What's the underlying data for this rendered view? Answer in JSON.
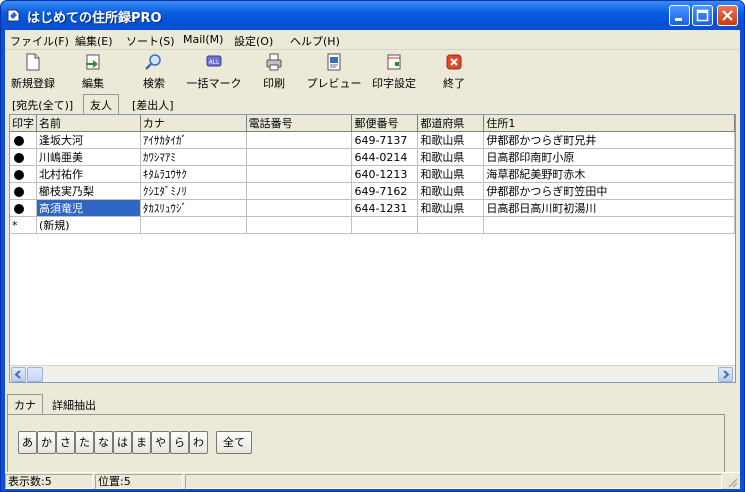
{
  "window": {
    "title": "はじめての住所録PRO",
    "title_color": "#0a4fd6"
  },
  "menubar": [
    "ファイル(F)",
    "編集(E)",
    "ソート(S)",
    "Mail(M)",
    "設定(O)",
    "ヘルプ(H)"
  ],
  "toolbar": [
    {
      "label": "新規登録",
      "icon": "new-document-icon"
    },
    {
      "label": "編集",
      "icon": "edit-icon"
    },
    {
      "label": "検索",
      "icon": "search-icon"
    },
    {
      "label": "一括マーク",
      "icon": "mark-all-icon"
    },
    {
      "label": "印刷",
      "icon": "printer-icon"
    },
    {
      "label": "プレビュー",
      "icon": "preview-icon"
    },
    {
      "label": "印字設定",
      "icon": "print-setup-icon"
    },
    {
      "label": "終了",
      "icon": "exit-icon"
    }
  ],
  "list_tabs": [
    "[宛先(全て)]",
    "友人",
    "[差出人]"
  ],
  "active_list_tab": "友人",
  "grid": {
    "columns": [
      "印字",
      "名前",
      "カナ",
      "電話番号",
      "郵便番号",
      "都道府県",
      "住所1"
    ],
    "rows": [
      {
        "mark": true,
        "name": "逢坂大河",
        "kana": "ｱｲｻｶﾀｲｶﾞ",
        "phone": "",
        "zip": "649-7137",
        "pref": "和歌山県",
        "addr": "伊都郡かつらぎ町兄井"
      },
      {
        "mark": true,
        "name": "川嶋亜美",
        "kana": "ｶﾜｼﾏｱﾐ",
        "phone": "",
        "zip": "644-0214",
        "pref": "和歌山県",
        "addr": "日高郡印南町小原"
      },
      {
        "mark": true,
        "name": "北村祐作",
        "kana": "ｷﾀﾑﾗﾕｳｻｸ",
        "phone": "",
        "zip": "640-1213",
        "pref": "和歌山県",
        "addr": "海草郡紀美野町赤木"
      },
      {
        "mark": true,
        "name": "櫛枝実乃梨",
        "kana": "ｸｼｴﾀﾞﾐﾉﾘ",
        "phone": "",
        "zip": "649-7162",
        "pref": "和歌山県",
        "addr": "伊都郡かつらぎ町笠田中"
      },
      {
        "mark": true,
        "name": "高須竜児",
        "kana": "ﾀｶｽﾘｭｳｼﾞ",
        "phone": "",
        "zip": "644-1231",
        "pref": "和歌山県",
        "addr": "日高郡日高川町初湯川",
        "selected": true
      }
    ],
    "new_row_marker": "*",
    "new_row_label": "(新規)"
  },
  "filter_tabs": [
    "カナ",
    "詳細抽出"
  ],
  "active_filter_tab": "カナ",
  "kana_buttons": [
    "あ",
    "か",
    "さ",
    "た",
    "な",
    "は",
    "ま",
    "や",
    "ら",
    "わ"
  ],
  "all_button": "全て",
  "status": {
    "count": "表示数:5",
    "position": "位置:5"
  },
  "colors": {
    "selection": "#3166c5",
    "titlebar": "#0a5fe0",
    "close_button": "#c83b14"
  }
}
